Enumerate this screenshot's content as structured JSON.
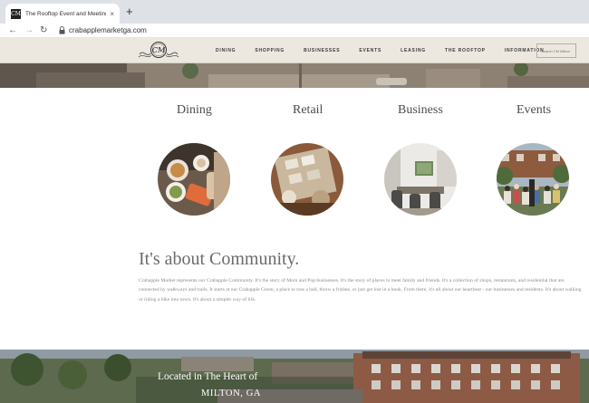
{
  "browser": {
    "tab_title": "The Rooftop Event and Meeting Sp",
    "favicon_text": "CM",
    "new_tab": "+",
    "close": "×",
    "back": "←",
    "forward": "→",
    "reload": "↻",
    "url": "crabapplemarketga.com"
  },
  "header": {
    "logo_text": "CM",
    "nav": [
      "DINING",
      "SHOPPING",
      "BUSINESSES",
      "EVENTS",
      "LEASING",
      "THE ROOFTOP",
      "INFORMATION"
    ],
    "search_placeholder": "Search CM Milton"
  },
  "categories": [
    {
      "title": "Dining",
      "icon": "dining-photo"
    },
    {
      "title": "Retail",
      "icon": "retail-photo"
    },
    {
      "title": "Business",
      "icon": "business-photo"
    },
    {
      "title": "Events",
      "icon": "events-photo"
    }
  ],
  "community": {
    "heading": "It's about Community.",
    "body": "Crabapple Market represents our Crabapple Community. It's the story of Mom and Pop businesses. It's the story of places to meet family and friends. It's a collection of shops, restaurants, and residential that are connected by walkways and trails. It starts at our Crabapple Green, a place to toss a ball, throw a frisbee, or just get lost in a book. From there, it's all about our heartbeat - our businesses and residents. It's about walking or riding a bike into town. It's about a simpler way of life."
  },
  "location": {
    "line1": "Located in The Heart of",
    "line2": "MILTON, GA"
  },
  "colors": {
    "header_bg": "#ece8e0",
    "text_gray": "#4d4d4d"
  }
}
